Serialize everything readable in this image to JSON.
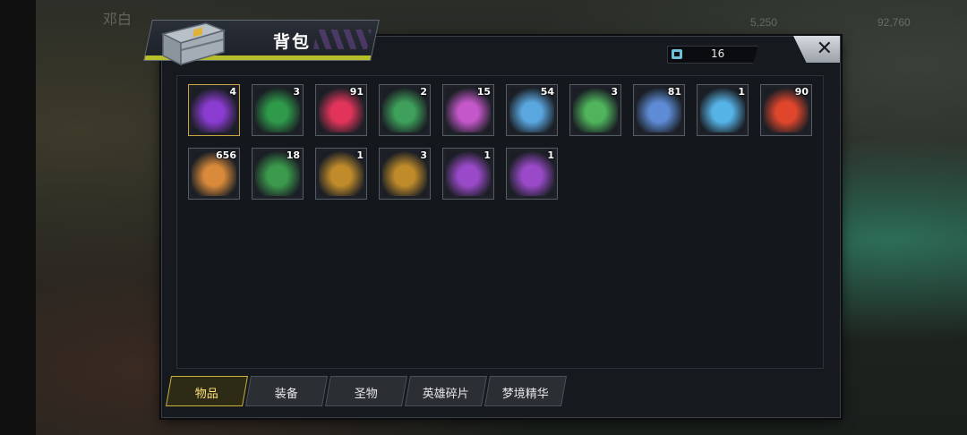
{
  "window": {
    "title": "背包",
    "close_symbol": "✕"
  },
  "capacity": {
    "icon": "bag-icon",
    "value": "16"
  },
  "items": [
    {
      "name": "treasure-chest",
      "count": "4",
      "rarity": "gold",
      "color": "#8a3bd0"
    },
    {
      "name": "festive-hat",
      "count": "3",
      "rarity": "normal",
      "color": "#2e9a4a"
    },
    {
      "name": "lips-badge",
      "count": "91",
      "rarity": "normal",
      "color": "#e2345a"
    },
    {
      "name": "green-cap-with-glasses",
      "count": "2",
      "rarity": "normal",
      "color": "#3ea05a"
    },
    {
      "name": "film-reel",
      "count": "15",
      "rarity": "normal",
      "color": "#c457c9"
    },
    {
      "name": "star-badge",
      "count": "54",
      "rarity": "normal",
      "color": "#5aa7e0"
    },
    {
      "name": "green-fedora",
      "count": "3",
      "rarity": "normal",
      "color": "#4fb45c"
    },
    {
      "name": "cinema-ticket",
      "count": "81",
      "rarity": "normal",
      "color": "#5d8bd6"
    },
    {
      "name": "bottle-cap-b",
      "count": "1",
      "rarity": "normal",
      "color": "#56b3e6"
    },
    {
      "name": "poker-chip",
      "count": "90",
      "rarity": "normal",
      "color": "#e0462c"
    },
    {
      "name": "bullet",
      "count": "656",
      "rarity": "normal",
      "color": "#d98a3a"
    },
    {
      "name": "green-cap",
      "count": "18",
      "rarity": "normal",
      "color": "#3b9a4c"
    },
    {
      "name": "gold-weapon-card",
      "count": "1",
      "rarity": "normal",
      "color": "#c08b2a"
    },
    {
      "name": "gold-hat-card",
      "count": "3",
      "rarity": "normal",
      "color": "#c08b2a"
    },
    {
      "name": "purple-hat-card",
      "count": "1",
      "rarity": "normal",
      "color": "#9a4ac9"
    },
    {
      "name": "purple-shirt-card",
      "count": "1",
      "rarity": "normal",
      "color": "#9a4ac9"
    }
  ],
  "tabs": [
    {
      "label": "物品",
      "active": true
    },
    {
      "label": "装备",
      "active": false
    },
    {
      "label": "圣物",
      "active": false
    },
    {
      "label": "英雄碎片",
      "active": false
    },
    {
      "label": "梦境精华",
      "active": false
    }
  ],
  "background_hud": {
    "player_name": "邓白",
    "gold": "5,250",
    "diamonds": "92,760"
  },
  "colors": {
    "accent": "#b7bf2a",
    "active_tab": "#cbb33a",
    "panel": "#161a1f"
  }
}
